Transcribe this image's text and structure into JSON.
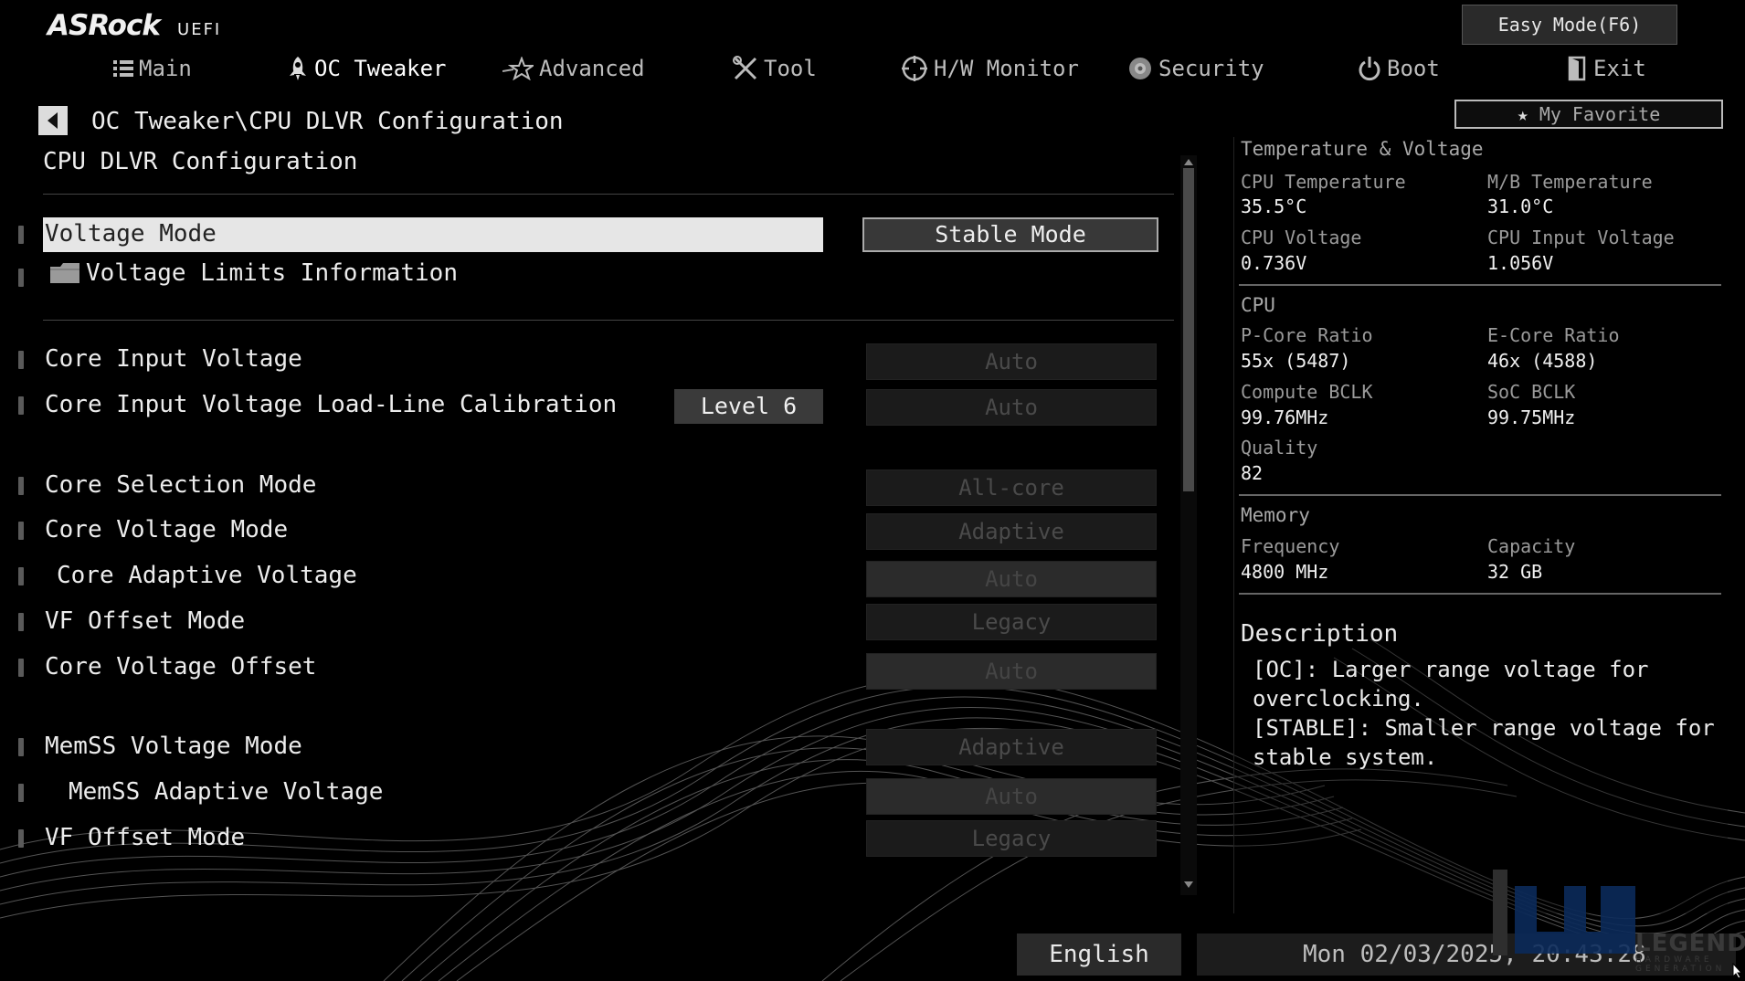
{
  "header": {
    "brand": "ASRock",
    "uefi": "UEFI",
    "easy_mode": "Easy Mode(F6)",
    "my_favorite": "My Favorite"
  },
  "tabs": [
    {
      "label": "Main",
      "icon": "list-icon"
    },
    {
      "label": "OC Tweaker",
      "icon": "rocket-icon",
      "active": true
    },
    {
      "label": "Advanced",
      "icon": "star-icon"
    },
    {
      "label": "Tool",
      "icon": "tools-icon"
    },
    {
      "label": "H/W Monitor",
      "icon": "monitor-icon"
    },
    {
      "label": "Security",
      "icon": "shield-icon"
    },
    {
      "label": "Boot",
      "icon": "power-icon"
    },
    {
      "label": "Exit",
      "icon": "exit-icon"
    }
  ],
  "breadcrumb": "OC Tweaker\\CPU DLVR Configuration",
  "page_title": "CPU DLVR Configuration",
  "settings": {
    "voltage_mode": {
      "label": "Voltage Mode",
      "value": "Stable Mode"
    },
    "voltage_limits": {
      "label": "Voltage Limits Information"
    },
    "core_input_voltage": {
      "label": "Core Input Voltage",
      "value": "Auto"
    },
    "core_input_llc": {
      "label": "Core Input Voltage Load-Line Calibration",
      "badge": "Level 6",
      "value": "Auto"
    },
    "core_selection_mode": {
      "label": "Core Selection Mode",
      "value": "All-core"
    },
    "core_voltage_mode": {
      "label": "Core Voltage Mode",
      "value": "Adaptive"
    },
    "core_adaptive_voltage": {
      "label": "Core Adaptive Voltage",
      "value": "Auto"
    },
    "vf_offset_mode": {
      "label": "VF Offset Mode",
      "value": "Legacy"
    },
    "core_voltage_offset": {
      "label": "Core Voltage Offset",
      "value": "Auto"
    },
    "memss_voltage_mode": {
      "label": "MemSS Voltage Mode",
      "value": "Adaptive"
    },
    "memss_adaptive_voltage": {
      "label": "MemSS Adaptive Voltage",
      "value": "Auto"
    },
    "vf_offset_mode_2": {
      "label": "VF Offset Mode",
      "value": "Legacy"
    }
  },
  "info": {
    "temp_voltage": {
      "heading": "Temperature & Voltage",
      "cpu_temp_label": "CPU Temperature",
      "cpu_temp": "35.5°C",
      "mb_temp_label": "M/B Temperature",
      "mb_temp": "31.0°C",
      "cpu_voltage_label": "CPU Voltage",
      "cpu_voltage": "0.736V",
      "cpu_input_voltage_label": "CPU Input Voltage",
      "cpu_input_voltage": "1.056V"
    },
    "cpu": {
      "heading": "CPU",
      "pcore_label": "P-Core Ratio",
      "pcore": "55x (5487)",
      "ecore_label": "E-Core Ratio",
      "ecore": "46x (4588)",
      "compute_bclk_label": "Compute BCLK",
      "compute_bclk": "99.76MHz",
      "soc_bclk_label": "SoC BCLK",
      "soc_bclk": "99.75MHz",
      "quality_label": "Quality",
      "quality": "82"
    },
    "memory": {
      "heading": "Memory",
      "frequency_label": "Frequency",
      "frequency": "4800 MHz",
      "capacity_label": "Capacity",
      "capacity": "32 GB"
    },
    "description": {
      "title": "Description",
      "lines": [
        "[OC]: Larger range voltage for",
        "overclocking.",
        "[STABLE]: Smaller range voltage for",
        "stable system."
      ]
    }
  },
  "footer": {
    "language": "English",
    "datetime": "Mon 02/03/2025, 20:43:28"
  },
  "watermark": {
    "text": "LEGEND",
    "sub": "HARDWARE GENERATION"
  },
  "colors": {
    "background": "#000000",
    "selected_row": "#e6e6e6",
    "disabled_value": "#1b1b1b"
  }
}
